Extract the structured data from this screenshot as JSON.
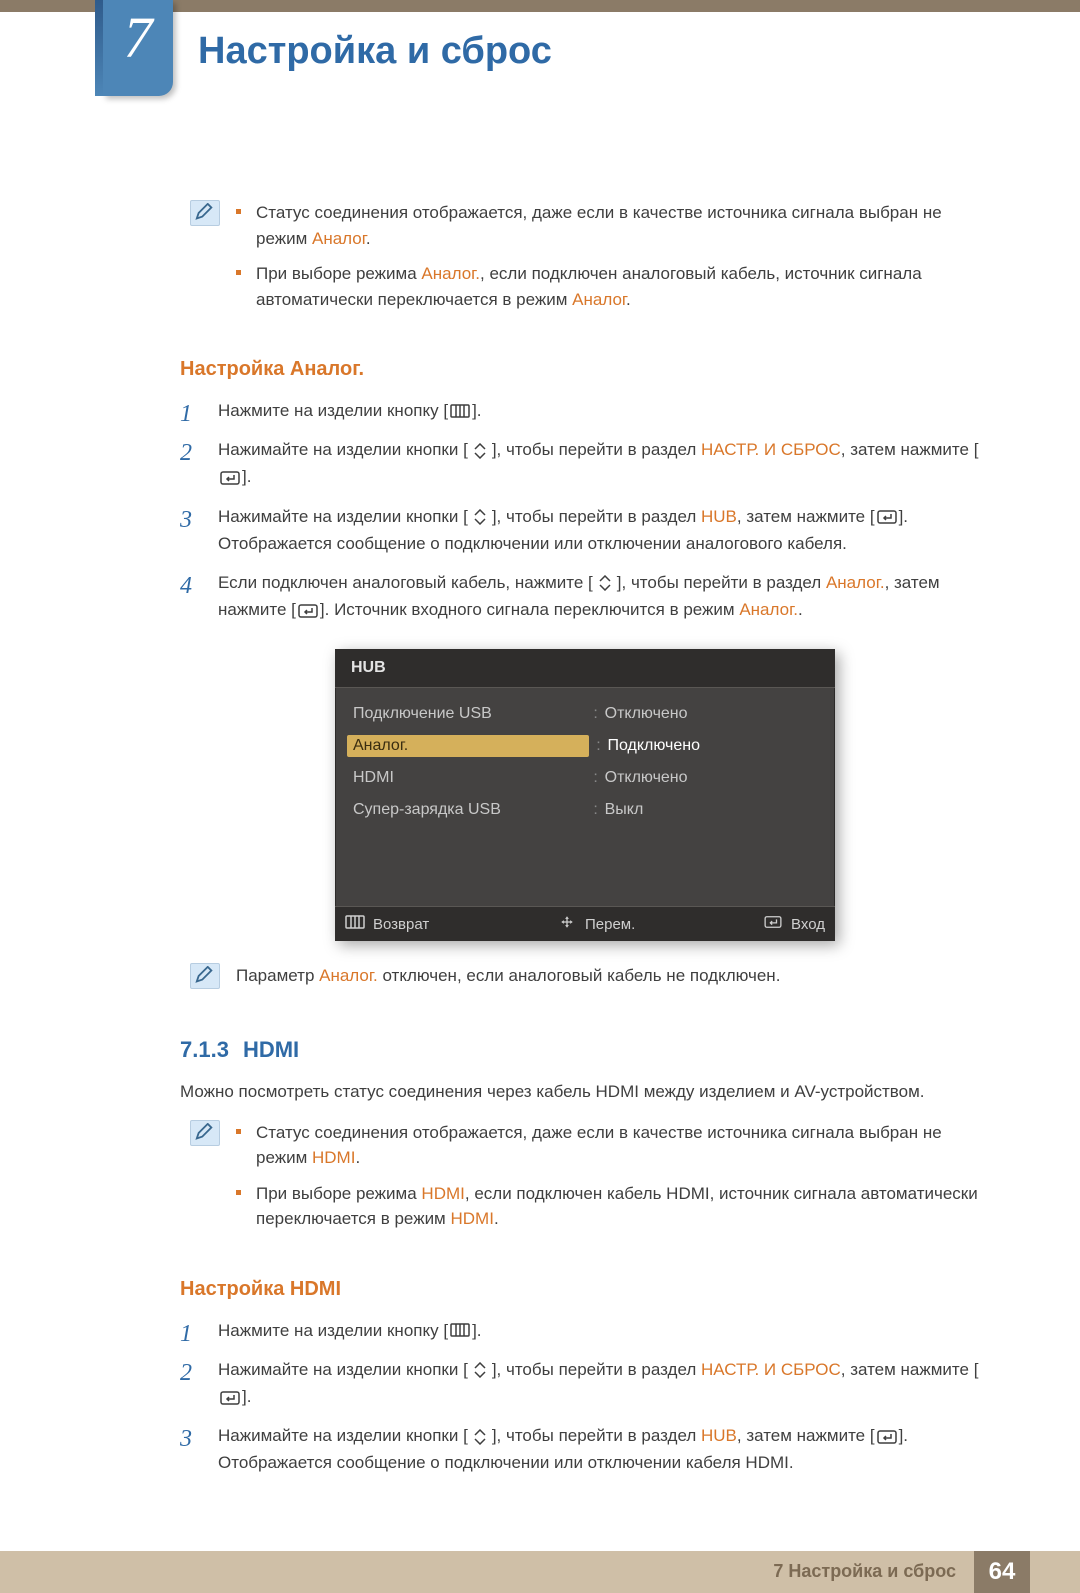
{
  "header": {
    "chapter_number": "7",
    "chapter_title": "Настройка и сброс"
  },
  "note1": {
    "bullets": [
      {
        "pre": "Статус соединения отображается, даже если в качестве источника сигнала выбран не режим ",
        "hl1": "Аналог",
        "post": "."
      },
      {
        "pre": "При выборе режима ",
        "hl1": "Аналог.",
        "mid": ", если подключен аналоговый кабель, источник сигнала автоматически переключается в режим ",
        "hl2": "Аналог",
        "post": "."
      }
    ]
  },
  "subheading_analog": "Настройка Аналог.",
  "steps_analog": {
    "s1": {
      "t1": "Нажмите на изделии кнопку [",
      "t2": "]."
    },
    "s2": {
      "t1": "Нажимайте на изделии кнопки [",
      "t2": "], чтобы перейти в раздел ",
      "hl1": "НАСТР. И СБРОС",
      "t3": ", затем нажмите [",
      "t4": "]."
    },
    "s3": {
      "t1": "Нажимайте на изделии кнопки [",
      "t2": "], чтобы перейти в раздел ",
      "hl1": "HUB",
      "t3": ", затем нажмите [",
      "t4": "]. ",
      "t5": "Отображается сообщение о подключении или отключении аналогового кабеля."
    },
    "s4": {
      "t1": "Если подключен аналоговый кабель, нажмите [",
      "t2": "], чтобы перейти в раздел ",
      "hl1": "Аналог.",
      "t3": ", затем нажмите [",
      "t4": "]. Источник входного сигнала переключится в режим ",
      "hl2": "Аналог.",
      "t5": "."
    }
  },
  "osd": {
    "title": "HUB",
    "rows": [
      {
        "label": "Подключение USB",
        "value": "Отключено",
        "selected": false
      },
      {
        "label": "Аналог.",
        "value": "Подключено",
        "selected": true
      },
      {
        "label": "HDMI",
        "value": "Отключено",
        "selected": false
      },
      {
        "label": "Супер-зарядка USB",
        "value": "Выкл",
        "selected": false
      }
    ],
    "footer": {
      "return": "Возврат",
      "move": "Перем.",
      "enter": "Вход"
    }
  },
  "note_after_osd": {
    "pre": "Параметр ",
    "hl": "Аналог.",
    "post": " отключен, если аналоговый кабель не подключен."
  },
  "section_hdmi": {
    "number": "7.1.3",
    "title": "HDMI",
    "intro": "Можно посмотреть статус соединения через кабель HDMI между изделием и AV-устройством."
  },
  "note_hdmi": {
    "bullets": [
      {
        "pre": "Статус соединения отображается, даже если в качестве источника сигнала выбран не режим ",
        "hl1": "HDMI",
        "post": "."
      },
      {
        "pre": "При выборе режима ",
        "hl1": "HDMI",
        "mid": ", если подключен кабель HDMI, источник сигнала автоматически переключается в режим ",
        "hl2": "HDMI",
        "post": "."
      }
    ]
  },
  "subheading_hdmi": "Настройка HDMI",
  "steps_hdmi": {
    "s1": {
      "t1": "Нажмите на изделии кнопку [",
      "t2": "]."
    },
    "s2": {
      "t1": "Нажимайте на изделии кнопки [",
      "t2": "], чтобы перейти в раздел ",
      "hl1": "НАСТР. И СБРОС",
      "t3": ", затем нажмите [",
      "t4": "]."
    },
    "s3": {
      "t1": "Нажимайте на изделии кнопки [",
      "t2": "], чтобы перейти в раздел ",
      "hl1": "HUB",
      "t3": ", затем нажмите [",
      "t4": "]. ",
      "t5": "Отображается сообщение о подключении или отключении кабеля HDMI."
    }
  },
  "footer": {
    "text": "7 Настройка и сброс",
    "page": "64"
  }
}
